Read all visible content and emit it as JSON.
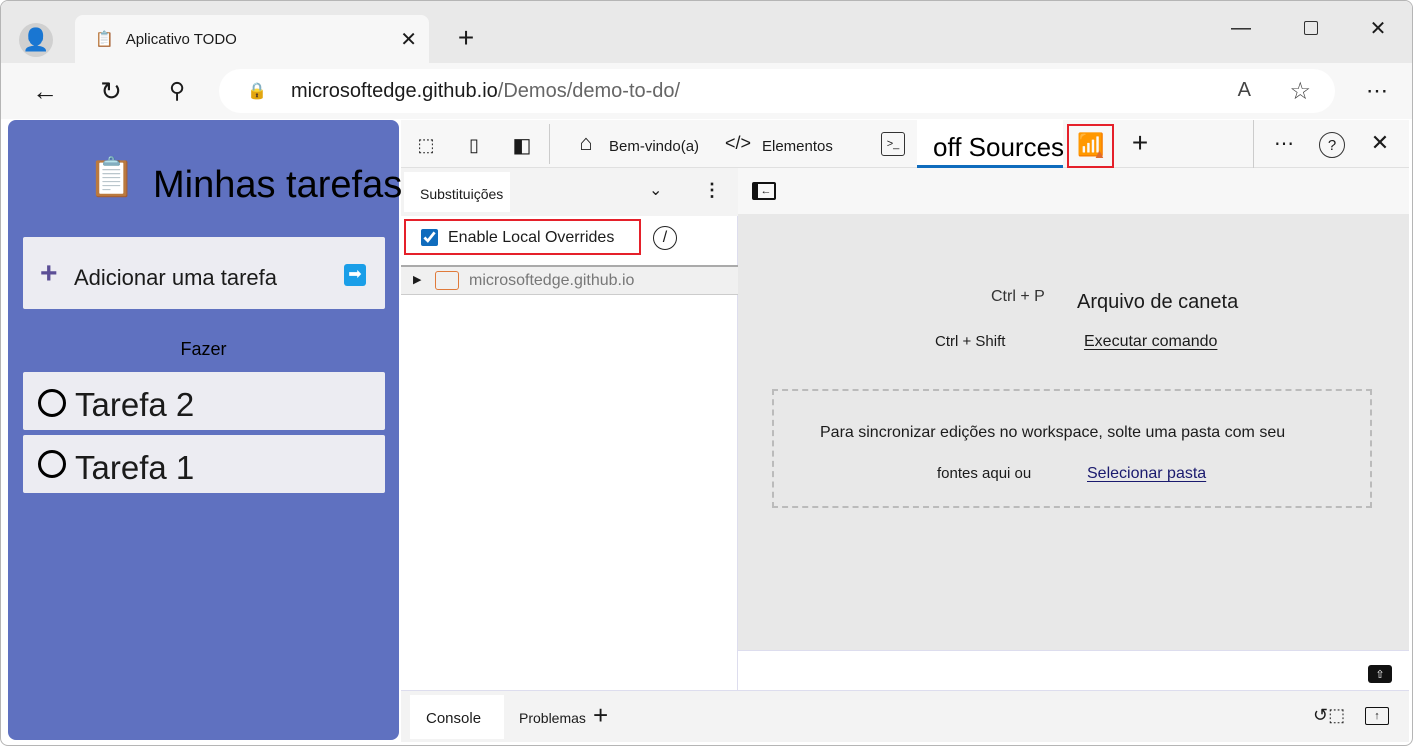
{
  "browser": {
    "tab_title": "Aplicativo TODO",
    "url_host": "microsoftedge.github.io",
    "url_path": "/Demos/demo-to-do/"
  },
  "app": {
    "title": "Minhas tarefas",
    "add_task": "Adicionar uma tarefa",
    "section": "Fazer",
    "tasks": [
      "Tarefa 2",
      "Tarefa 1"
    ],
    "background": "#5f71c0"
  },
  "devtools": {
    "tabs": {
      "welcome": "Bem-vindo(a)",
      "elements": "Elementos",
      "sources": "off Sources"
    },
    "sidebar": {
      "panel": "Substituições",
      "enable_overrides": "Enable Local Overrides",
      "enable_overrides_checked": true,
      "folder": "microsoftedge.github.io"
    },
    "main": {
      "shortcut1_key": "Ctrl + P",
      "shortcut1_label": "Arquivo de caneta",
      "shortcut2_key": "Ctrl + Shift",
      "shortcut2_label": "Executar comando",
      "drop_text": "Para sincronizar edições no workspace, solte uma pasta com seu",
      "drop_text2": "fontes aqui ou",
      "select_folder": "Selecionar pasta"
    },
    "drawer": {
      "console": "Console",
      "issues": "Problemas"
    },
    "accent": "#0f6cbd",
    "highlight": "#e5202a"
  }
}
